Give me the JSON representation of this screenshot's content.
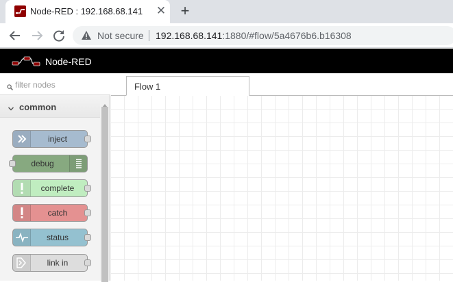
{
  "browser": {
    "tab_title": "Node-RED : 192.168.68.141",
    "close_glyph": "✕",
    "new_tab_glyph": "+",
    "security_label": "Not secure",
    "url_host": "192.168.68.141",
    "url_rest": ":1880/#flow/5a4676b6.b16308"
  },
  "app": {
    "title": "Node-RED"
  },
  "palette": {
    "filter_placeholder": "filter nodes",
    "category": "common",
    "nodes": [
      {
        "label": "inject",
        "color": "#a6bbcf"
      },
      {
        "label": "debug",
        "color": "#87a980"
      },
      {
        "label": "complete",
        "color": "#c0edc0"
      },
      {
        "label": "catch",
        "color": "#e49191"
      },
      {
        "label": "status",
        "color": "#94c1d0"
      },
      {
        "label": "link in",
        "color": "#dddddd"
      }
    ]
  },
  "workspace": {
    "tabs": [
      {
        "label": "Flow 1"
      }
    ]
  }
}
